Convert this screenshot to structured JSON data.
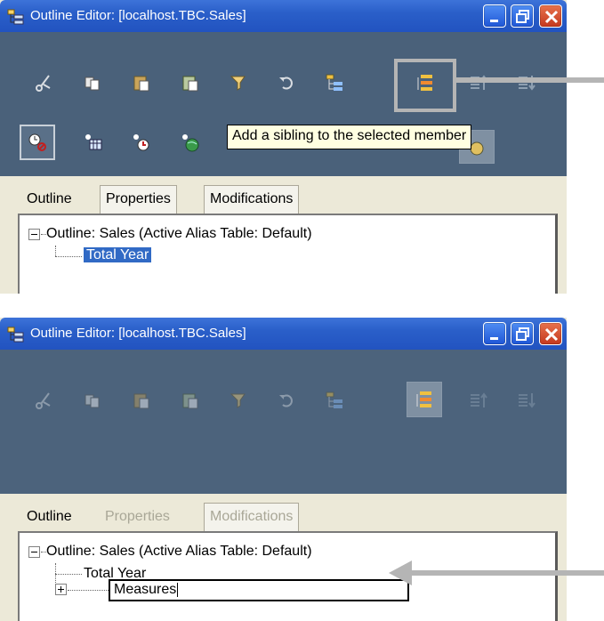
{
  "panel1": {
    "title": "Outline Editor: [localhost.TBC.Sales]",
    "tooltip": "Add a sibling to the selected member",
    "tabs": [
      "Outline",
      "Properties",
      "Modifications"
    ],
    "tree": {
      "root": "Outline: Sales (Active Alias Table: Default)",
      "child": "Total Year"
    }
  },
  "panel2": {
    "title": "Outline Editor: [localhost.TBC.Sales]",
    "tabs": [
      "Outline",
      "Properties",
      "Modifications"
    ],
    "tree": {
      "root": "Outline: Sales (Active Alias Table: Default)",
      "child": "Total Year"
    },
    "edit_value": "Measures"
  },
  "icons": {
    "toolbar_row1": [
      "cut-icon",
      "copy-icon",
      "paste-icon",
      "paste-special-icon",
      "filter-icon",
      "undo-icon",
      "add-child-icon",
      "add-sibling-icon",
      "move-up-icon",
      "move-down-icon"
    ],
    "toolbar_row2": [
      "clock-icon",
      "calendar-icon",
      "time-icon",
      "globe-icon"
    ]
  },
  "colors": {
    "titlebar": "#2253c0",
    "toolbar_bg": "#4a617a",
    "selection": "#316ac5",
    "tooltip_bg": "#ffffe1",
    "callout": "#b5b5b5"
  }
}
